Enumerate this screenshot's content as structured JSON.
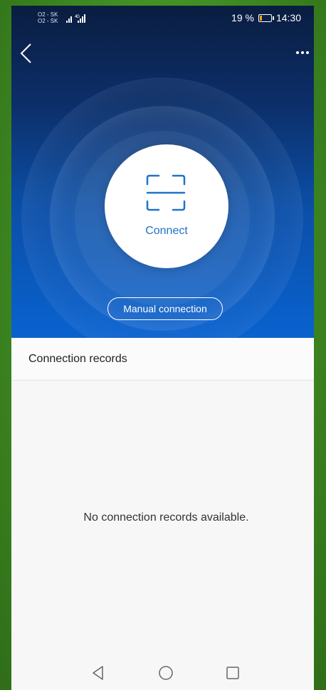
{
  "status_bar": {
    "carrier_1": "O2 - SK",
    "carrier_2": "O2 - SK",
    "network": "4G",
    "battery_percent": "19 %",
    "time": "14:30",
    "battery_level": 0.19
  },
  "header": {
    "back_icon": "chevron-left-icon",
    "more_icon": "more-dots-icon"
  },
  "hero": {
    "connect_label": "Connect",
    "scan_icon": "scan-frame-icon",
    "manual_button_label": "Manual connection"
  },
  "records": {
    "title": "Connection records",
    "empty_message": "No connection records available."
  },
  "nav_bar": {
    "back": "triangle-back-icon",
    "home": "circle-home-icon",
    "recents": "square-recents-icon"
  },
  "colors": {
    "accent": "#1f73c9",
    "hero_top": "#0a1d40",
    "hero_bottom": "#0a62cf",
    "battery": "#f2a020"
  }
}
